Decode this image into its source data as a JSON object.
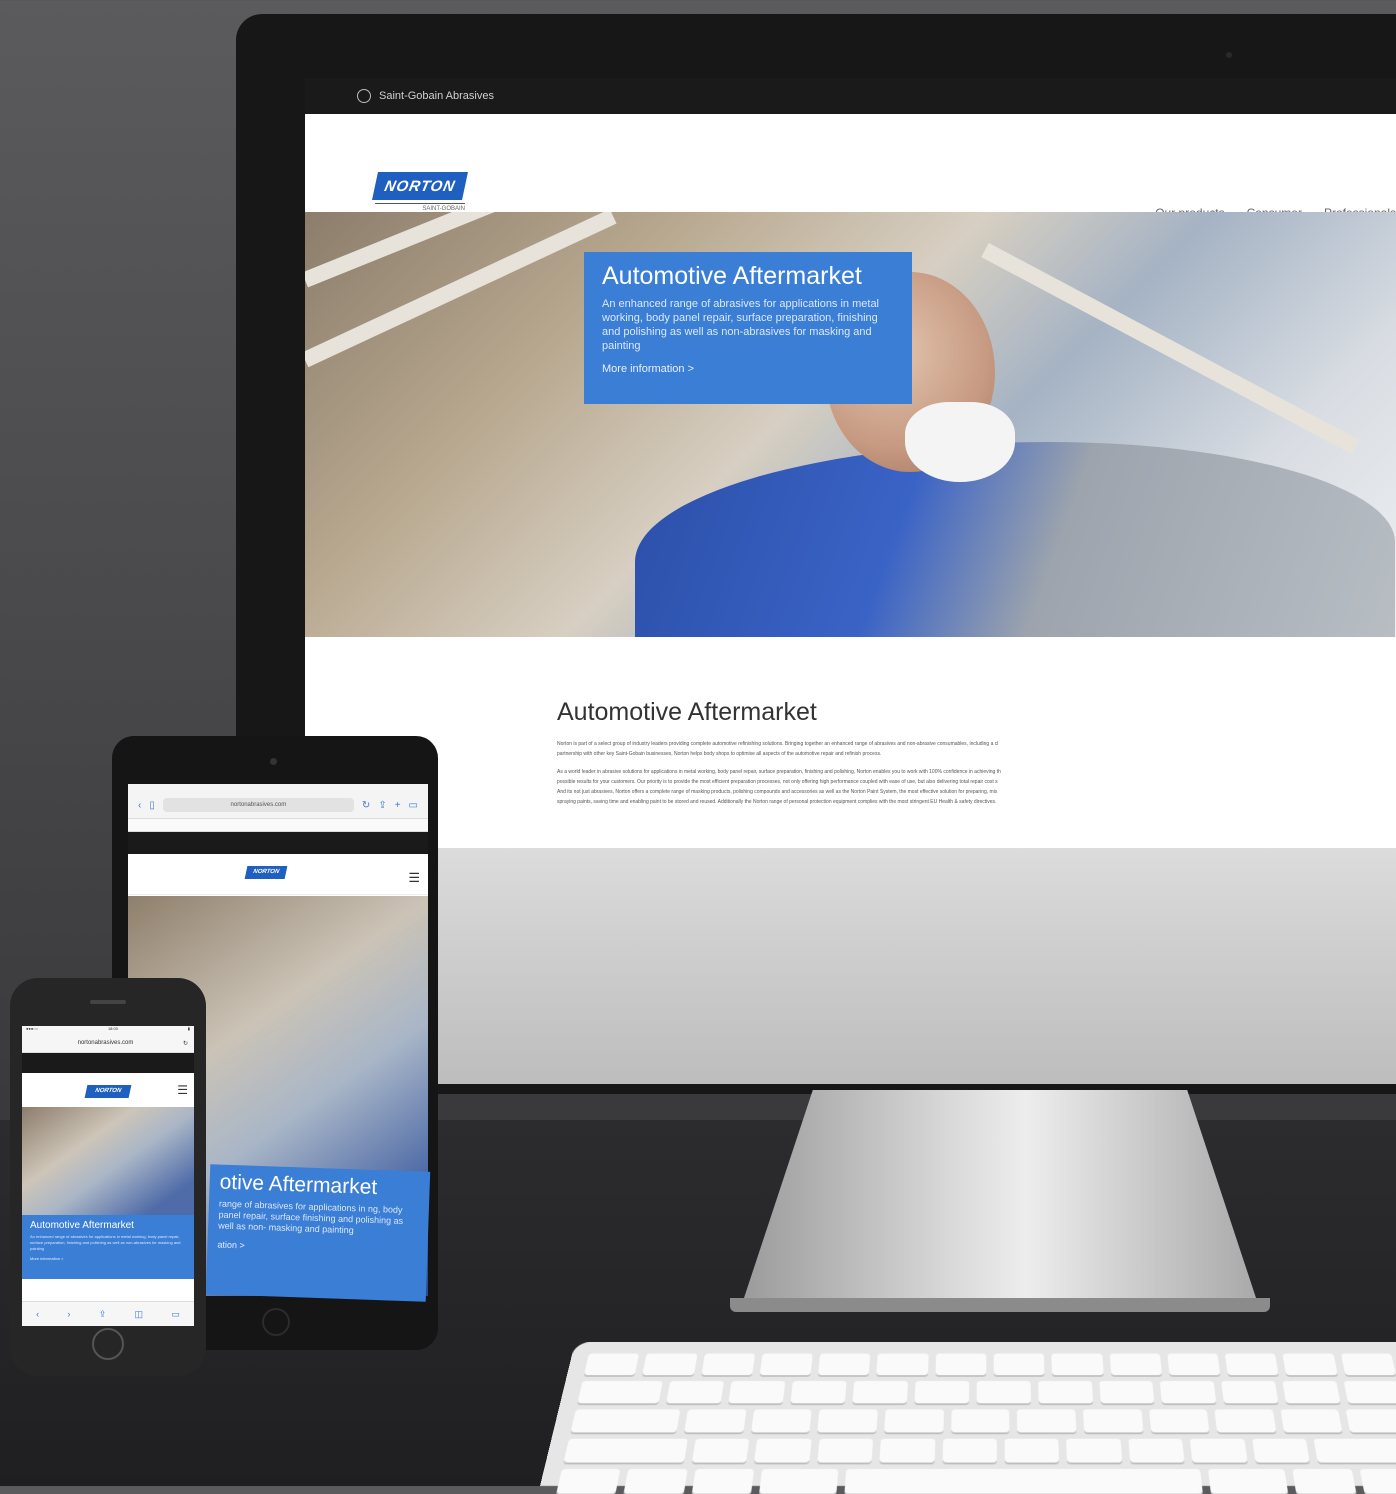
{
  "desktop": {
    "topbar_label": "Saint-Gobain Abrasives",
    "logo_text": "NORTON",
    "logo_sub": "SAINT-GOBAIN",
    "nav": [
      "Our products",
      "Consumer",
      "Professionals"
    ],
    "hero": {
      "title": "Automotive Aftermarket",
      "description": "An enhanced range of abrasives for applications in metal working, body panel repair, surface preparation, finishing and polishing as well as non-abrasives for masking and painting",
      "more": "More information >"
    },
    "article": {
      "title": "Automotive Aftermarket",
      "paragraphs": [
        "Norton is part of a select group of industry leaders providing complete automotive refinishing solutions. Bringing together an enhanced range of abrasives and non-abrasive consumables, including a cl",
        "partnership with other key Saint-Gobain businesses, Norton helps body shops to optimise all aspects of the automotive repair and refinish process.",
        "As a world leader in abrasive solutions for applications in metal working, body panel repair, surface preparation, finishing and polishing, Norton enables you to work with 100% confidence in achieving th",
        "possible results for your customers. Our priority is to provide the most efficient preparation processes, not only offering high performance coupled with ease of use, but also delivering total repair cost s",
        "And its not just abrasives, Norton offers a complete range of masking products, polishing compounds and accessories as well as the Norton Paint System, the most effective solution for preparing, mix",
        "spraying paints, saving time and enabling paint to be stored and reused. Additionally the Norton range of personal protection equipment complies with the most stringent EU Health & safety directives."
      ]
    }
  },
  "tablet": {
    "url": "nortonabrasives.com",
    "logo_text": "NORTON",
    "hero_title": "otive Aftermarket",
    "hero_desc": "range of abrasives for applications in ng, body panel repair, surface finishing and polishing as well as non- masking and painting",
    "hero_more": "ation >"
  },
  "phone": {
    "time": "18:00",
    "url": "nortonabrasives.com",
    "logo_text": "NORTON",
    "hero_title": "Automotive Aftermarket",
    "hero_desc": "An enhanced range of abrasives for applications in metal working, body panel repair, surface preparation, finishing and polishing as well as non-abrasives for masking and painting",
    "hero_more": "More information >"
  }
}
